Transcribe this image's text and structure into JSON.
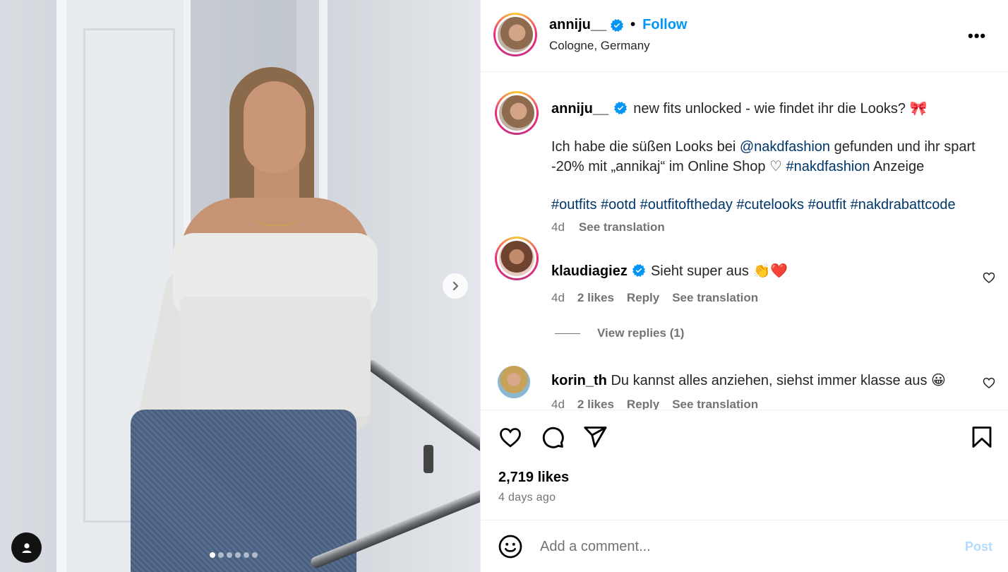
{
  "post": {
    "author": "anniju__",
    "follow_label": "Follow",
    "separator": "•",
    "location": "Cologne, Germany",
    "more_label": "•••"
  },
  "caption": {
    "author": "anniju__",
    "line1": "new fits unlocked - wie findet ihr die Looks?",
    "line1_emoji": "🎀",
    "p2_part1": "Ich habe die süßen Looks bei ",
    "mention": "@nakdfashion",
    "p2_part2": " gefunden und ihr spart -20% mit „annikaj“ im Online Shop ",
    "p2_heart": "♡",
    "hashtag_inline": "#nakdfashion",
    "p2_part3": " Anzeige",
    "hashtags": "#outfits #ootd #outfitoftheday #cutelooks #outfit #nakdrabattcode",
    "time": "4d",
    "see_translation": "See translation"
  },
  "comments": [
    {
      "author": "klaudiagiez",
      "text": "Sieht super aus",
      "emoji": "👏❤️",
      "time": "4d",
      "likes": "2 likes",
      "reply": "Reply",
      "see_translation": "See translation"
    },
    {
      "author": "korin_th",
      "text": "Du kannst alles anziehen, siehst immer klasse aus",
      "emoji": "😀",
      "time": "4d",
      "likes": "2 likes",
      "reply": "Reply",
      "see_translation": "See translation"
    }
  ],
  "view_replies": "View replies (1)",
  "stats": {
    "likes": "2,719 likes",
    "posted": "4 days ago"
  },
  "composer": {
    "placeholder": "Add a comment...",
    "post_label": "Post"
  },
  "carousel": {
    "slide_count": 6,
    "active_index": 0
  },
  "colors": {
    "follow": "#0095f6",
    "link": "#00376b",
    "muted": "#737373",
    "post_disabled": "#b3dbff",
    "verified": "#0095f6"
  },
  "icons": [
    "verified-icon",
    "more-icon",
    "heart-icon",
    "comment-icon",
    "share-icon",
    "bookmark-icon",
    "emoji-icon",
    "next-icon",
    "user-tag-icon"
  ]
}
